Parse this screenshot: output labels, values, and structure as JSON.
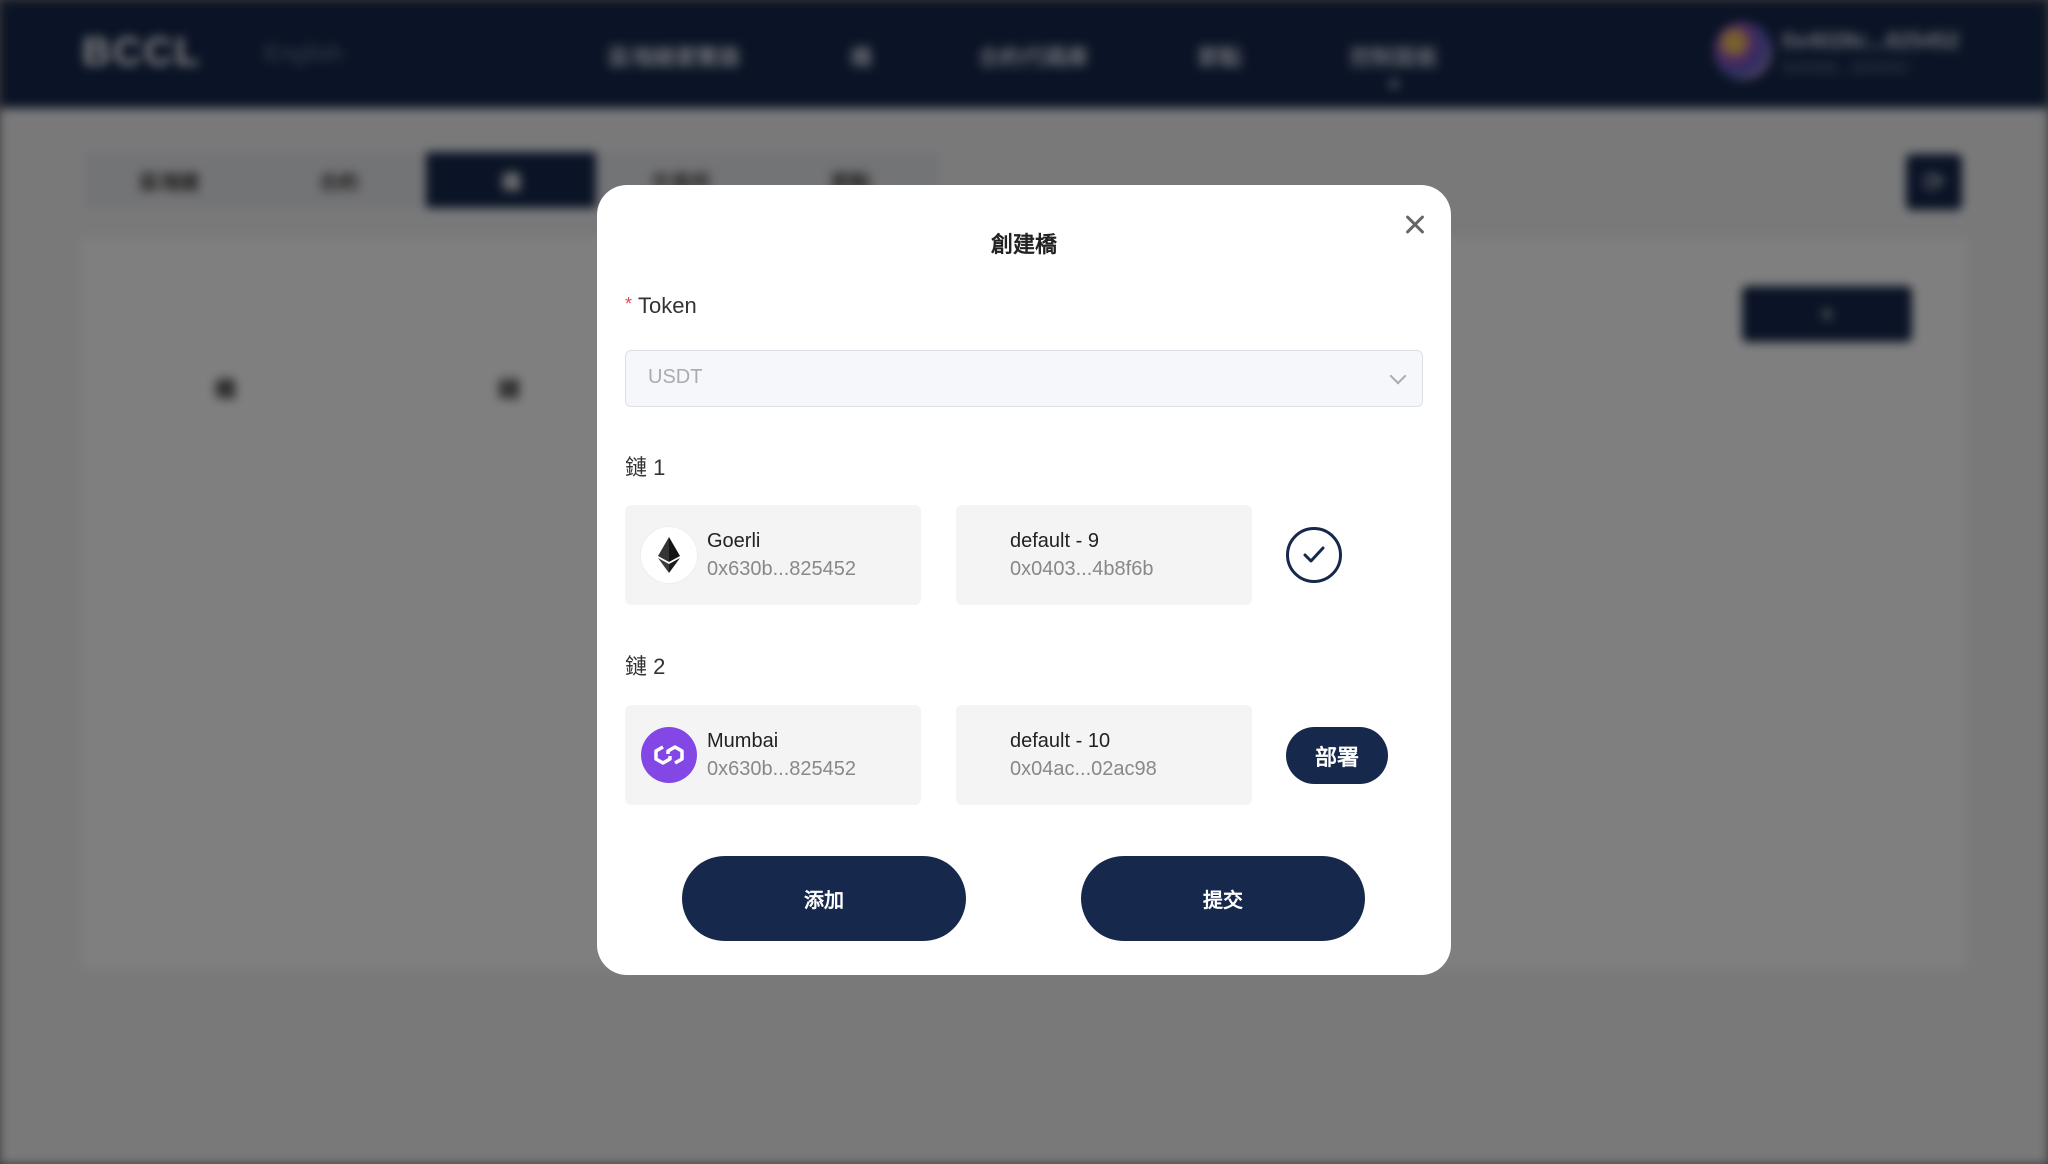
{
  "background": {
    "nav": {
      "logo": "BCCL",
      "language": "English",
      "items": [
        "區塊鏈瀏覽器",
        "橋",
        "合約代碼庫",
        "節點",
        "控制面板"
      ],
      "account_name": "0x4028c...825452",
      "account_sub": "0x630b...825452"
    },
    "tabs": [
      "區塊鏈",
      "合約",
      "橋",
      "交易所",
      "節點"
    ],
    "active_tab_index": 2,
    "columns": [
      "橋",
      "鏈"
    ]
  },
  "modal": {
    "title": "創建橋",
    "token_label": "Token",
    "token_required_mark": "*",
    "token_select": {
      "value": "USDT"
    },
    "chain1": {
      "label": "鏈 1",
      "network": {
        "icon": "ethereum-icon",
        "name": "Goerli",
        "address": "0x630b...825452"
      },
      "contract": {
        "name": "default - 9",
        "address": "0x0403...4b8f6b"
      },
      "status": "deployed"
    },
    "chain2": {
      "label": "鏈 2",
      "network": {
        "icon": "polygon-icon",
        "name": "Mumbai",
        "address": "0x630b...825452"
      },
      "contract": {
        "name": "default - 10",
        "address": "0x04ac...02ac98"
      },
      "deploy_label": "部署"
    },
    "add_label": "添加",
    "submit_label": "提交"
  },
  "colors": {
    "primary": "#16284c",
    "polygon": "#8247e5",
    "required": "#e5484d"
  }
}
